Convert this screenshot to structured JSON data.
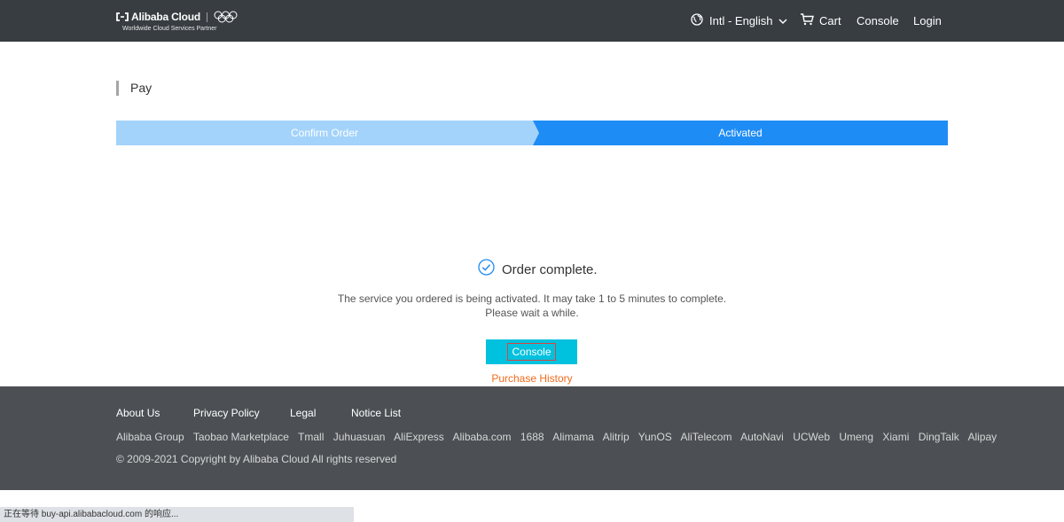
{
  "header": {
    "logo_text": "Alibaba Cloud",
    "logo_tagline": "Worldwide Cloud Services Partner",
    "language": "Intl - English",
    "cart": "Cart",
    "console": "Console",
    "login": "Login"
  },
  "page": {
    "title": "Pay"
  },
  "steps": [
    {
      "label": "Confirm Order",
      "state": "done"
    },
    {
      "label": "Activated",
      "state": "active"
    }
  ],
  "result": {
    "heading": "Order complete.",
    "line1": "The service you ordered is being activated. It may take 1 to 5 minutes to complete.",
    "line2": "Please wait a while.",
    "console_button": "Console",
    "purchase_history": "Purchase History"
  },
  "footer": {
    "nav": [
      "About Us",
      "Privacy Policy",
      "Legal",
      "Notice List"
    ],
    "links": [
      "Alibaba Group",
      "Taobao Marketplace",
      "Tmall",
      "Juhuasuan",
      "AliExpress",
      "Alibaba.com",
      "1688",
      "Alimama",
      "Alitrip",
      "YunOS",
      "AliTelecom",
      "AutoNavi",
      "UCWeb",
      "Umeng",
      "Xiami",
      "DingTalk",
      "Alipay"
    ],
    "copyright": "© 2009-2021 Copyright by Alibaba Cloud All rights reserved"
  },
  "statusbar": {
    "text": "正在等待 buy-api.alibabacloud.com 的响应..."
  },
  "colors": {
    "header_bg": "#373d41",
    "step_done": "#a3d3fb",
    "step_active": "#1e8cf5",
    "console_button": "#00c1de",
    "purchase_link": "#f06b1c",
    "footer_bg": "#4c5054"
  },
  "icons": [
    "alibaba-cloud-logo-icon",
    "olympic-rings-icon",
    "globe-icon",
    "chevron-down-icon",
    "cart-icon",
    "check-circle-icon"
  ]
}
